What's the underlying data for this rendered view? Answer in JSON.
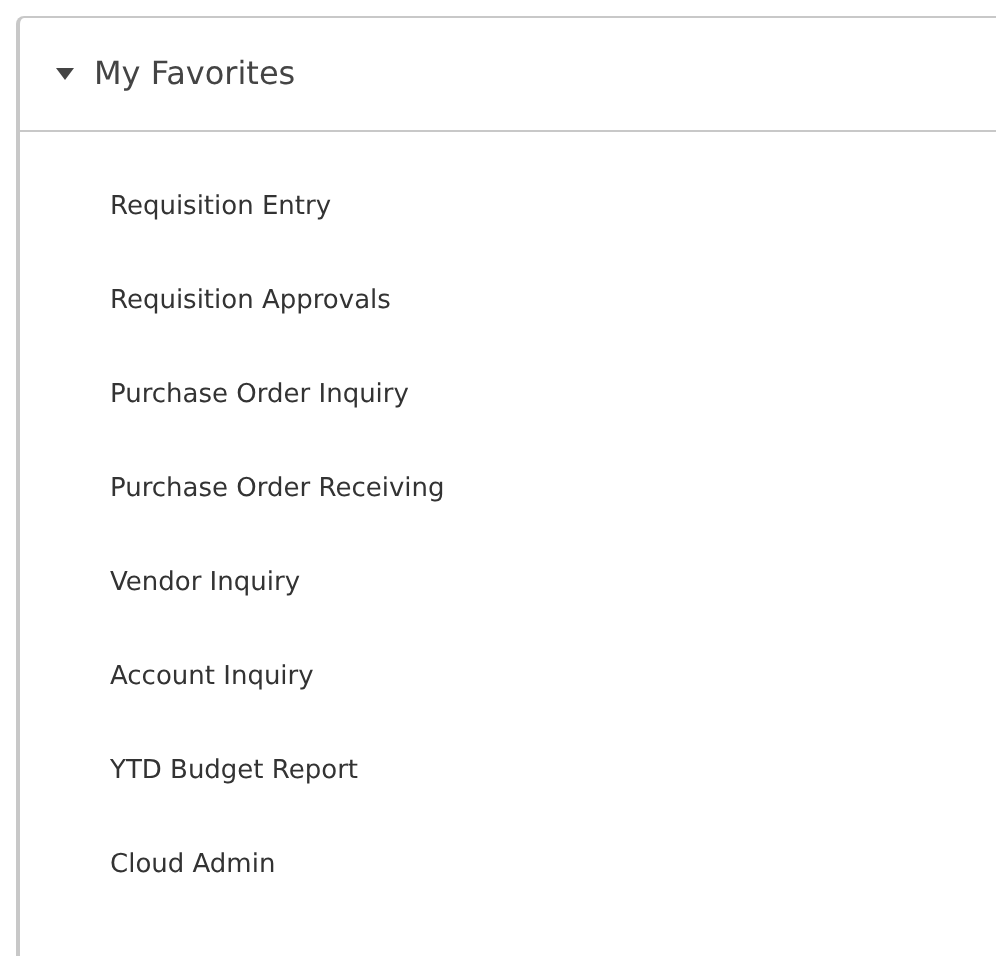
{
  "panel": {
    "title": "My Favorites",
    "expanded": true,
    "items": [
      {
        "label": "Requisition Entry"
      },
      {
        "label": "Requisition Approvals"
      },
      {
        "label": "Purchase Order Inquiry"
      },
      {
        "label": "Purchase Order Receiving"
      },
      {
        "label": "Vendor Inquiry"
      },
      {
        "label": "Account Inquiry"
      },
      {
        "label": "YTD Budget Report"
      },
      {
        "label": "Cloud Admin"
      }
    ]
  }
}
